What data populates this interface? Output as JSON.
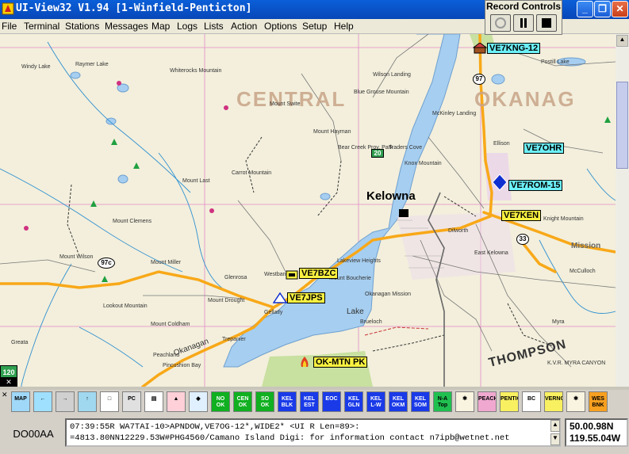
{
  "window": {
    "title": "UI-View32 V1.94 [1-Winfield-Penticton]",
    "minimize_glyph": "_",
    "maximize_glyph": "❐",
    "close_glyph": "✕"
  },
  "record_controls": {
    "title": "Record Controls"
  },
  "menu": [
    "File",
    "Terminal",
    "Stations",
    "Messages",
    "Map",
    "Logs",
    "Lists",
    "Action",
    "Options",
    "Setup",
    "Help"
  ],
  "map": {
    "region_labels": {
      "centre": "CENTRAL",
      "okanag": "OKANAG",
      "thompson": "THOMPSON"
    },
    "city": "Kelowna",
    "stations": {
      "ve7kng": "VE7KNG-12",
      "ve7ohr": "VE7OHR",
      "ve7rom": "VE7ROM-15",
      "ve7ken": "VE7KEN",
      "ve7bzc": "VE7BZC",
      "ve7jps": "VE7JPS",
      "okmtn": "OK-MTN PK"
    },
    "places": {
      "p1": "Whiterocks Mountain",
      "p2": "Windy Lake",
      "p3": "Raymer Lake",
      "p4": "Mount Swite",
      "p5": "Blue Grouse Mountain",
      "p6": "Wilson Landing",
      "p7": "McKinley Landing",
      "p8": "Mount Hayman",
      "p9": "Carrot Mountain",
      "p10": "Mount Last",
      "p11": "Mount Clemens",
      "p12": "Mount Wilson",
      "p13": "Mount Miller",
      "p14": "Glenrosa",
      "p15": "Mount Drought",
      "p16": "Westbank",
      "p17": "Gellatly",
      "p18": "Okanagan Mission",
      "p19": "Kelowna",
      "p20": "Peachland",
      "p21": "Trepanier",
      "p22": "Mount Coldham",
      "p23": "Lookout Mountain",
      "p24": "Mount Boucherie",
      "p25": "Lakeview Heights",
      "p26": "Traders Cove",
      "p27": "Knox Mountain",
      "p28": "Dilworth",
      "p29": "East Kelowna",
      "p30": "Knight Mountain",
      "p31": "McCulloch",
      "p32": "Myra",
      "p33": "K.V.R. MYRA CANYON",
      "p34": "Postill Lake",
      "p35": "Ellison",
      "p36": "Bear Creek Prov. Park",
      "p37": "Glenmore",
      "p38": "Rutland",
      "p39": "Mission",
      "p40": "Lake",
      "p41": "Okanagan",
      "p42": "Brueloch",
      "p43": "Peachland",
      "p44": "Greata",
      "p45": "Pincushion Bay"
    },
    "highway_numbers": {
      "h97": "97",
      "h97c": "97c",
      "h33": "33",
      "h20": "20"
    },
    "corner_tag": "120"
  },
  "toolbar": {
    "buttons": [
      {
        "label": "MAP",
        "bg": "#9fd8f8"
      },
      {
        "label": "←",
        "bg": "#9fe0ff"
      },
      {
        "label": "→",
        "bg": "#d0d0d0"
      },
      {
        "label": "↑",
        "bg": "#a0d8f0"
      },
      {
        "label": "□",
        "bg": "#ffffff"
      },
      {
        "label": "PC",
        "bg": "#e0e0e0"
      },
      {
        "label": "▤",
        "bg": "#ffffff"
      },
      {
        "label": "▲",
        "bg": "#ffd0d8"
      },
      {
        "label": "◆",
        "bg": "#e0f0ff"
      },
      {
        "label": "NO OK",
        "bg": "#10b020"
      },
      {
        "label": "CEN OK",
        "bg": "#10b020"
      },
      {
        "label": "SO OK",
        "bg": "#10b020"
      },
      {
        "label": "KEL BLK",
        "bg": "#1a3ae8"
      },
      {
        "label": "KEL EST",
        "bg": "#1a3ae8"
      },
      {
        "label": "EOC",
        "bg": "#1a3ae8"
      },
      {
        "label": "KEL GLN",
        "bg": "#1a3ae8"
      },
      {
        "label": "KEL L-W",
        "bg": "#1a3ae8"
      },
      {
        "label": "KEL OKM",
        "bg": "#1a3ae8"
      },
      {
        "label": "KEL SOM",
        "bg": "#1a3ae8"
      },
      {
        "label": "N-A Top",
        "bg": "#20c050"
      },
      {
        "label": "✱",
        "bg": "#f8f4e0"
      },
      {
        "label": "PEACH",
        "bg": "#f0a8d0"
      },
      {
        "label": "PENTIC",
        "bg": "#f8f060"
      },
      {
        "label": "BC",
        "bg": "#ffffff"
      },
      {
        "label": "VERNON",
        "bg": "#f8f060"
      },
      {
        "label": "✱",
        "bg": "#f8f4e0"
      },
      {
        "label": "WES BNK",
        "bg": "#f8a020"
      }
    ]
  },
  "status": {
    "grid": "DO00AA",
    "packet_line1": "07:39:55R WA7TAI-10>APNDOW,VE7OG-12*,WIDE2* <UI R Len=89>:",
    "packet_line2": "=4813.80NN12229.53W#PHG4560/Camano Island Digi: for information contact n7ipb@wetnet.net",
    "lat": "50.00.98N",
    "lon": "119.55.04W"
  }
}
